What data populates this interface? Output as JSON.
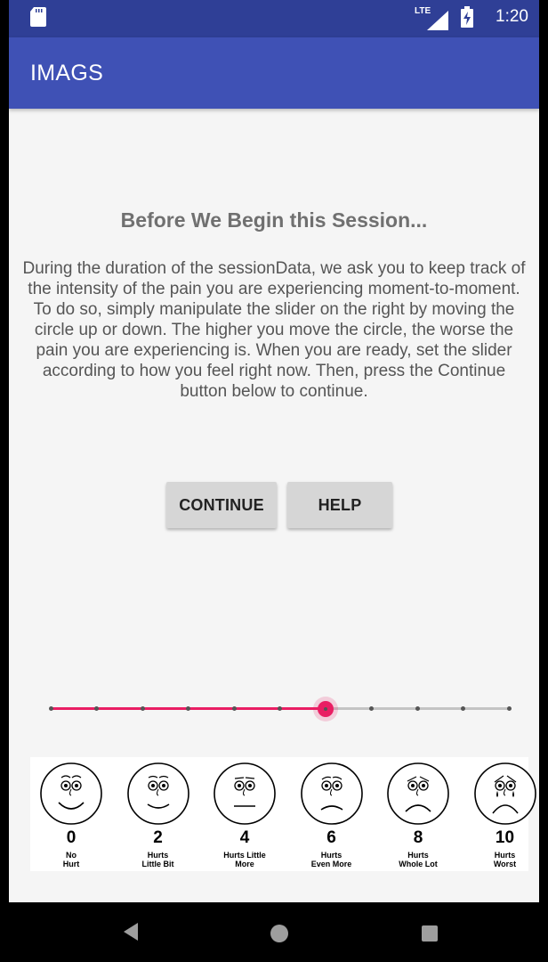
{
  "status_bar": {
    "time": "1:20",
    "network_label": "LTE",
    "icons": [
      "sd-card-icon",
      "lte-signal-icon",
      "battery-charging-icon"
    ]
  },
  "app_bar": {
    "title": "IMAGS"
  },
  "main": {
    "heading": "Before We Begin this Session...",
    "description": "During the duration of the sessionData, we ask you to keep track of the intensity of the pain you are experiencing moment-to-moment.\nTo do so, simply manipulate the slider on the right by moving the circle up or down. The higher you move the circle, the worse the pain you are experiencing is. When you are ready, set the slider according to how you feel right now. Then, press the Continue button below to continue.",
    "continue_label": "CONTINUE",
    "help_label": "HELP"
  },
  "slider": {
    "min": 0,
    "max": 10,
    "value": 6,
    "accent_color": "#e91e63"
  },
  "pain_scale": [
    {
      "number": "0",
      "label": "No\nHurt"
    },
    {
      "number": "2",
      "label": "Hurts\nLittle Bit"
    },
    {
      "number": "4",
      "label": "Hurts Little\nMore"
    },
    {
      "number": "6",
      "label": "Hurts\nEven More"
    },
    {
      "number": "8",
      "label": "Hurts\nWhole Lot"
    },
    {
      "number": "10",
      "label": "Hurts\nWorst"
    }
  ],
  "nav_bar": {
    "icons": [
      "back-icon",
      "home-icon",
      "recents-icon"
    ]
  },
  "colors": {
    "status_bar": "#2f3f96",
    "app_bar": "#3f51b5",
    "accent": "#e91e63",
    "background": "#f5f5f5"
  }
}
